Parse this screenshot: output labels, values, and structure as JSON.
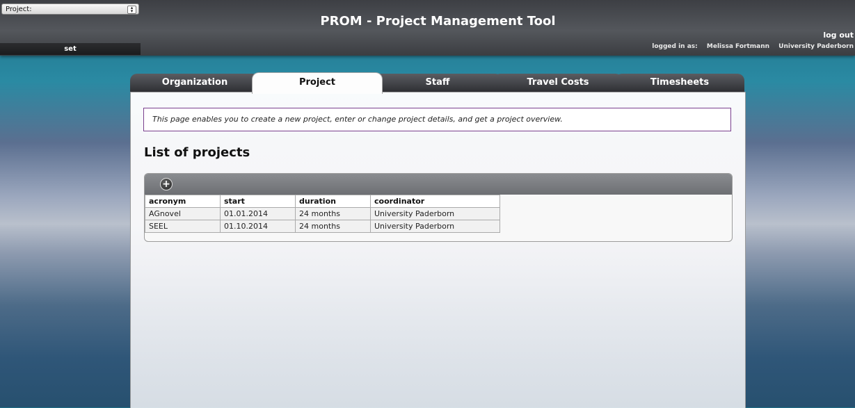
{
  "header": {
    "project_label": "Project:",
    "set_label": "set",
    "title": "PROM - Project Management Tool",
    "logout_label": "log out",
    "logged_in_label": "logged in as:",
    "user_name": "Melissa Fortmann",
    "organization": "University Paderborn"
  },
  "tabs": [
    {
      "label": "Organization"
    },
    {
      "label": "Project"
    },
    {
      "label": "Staff"
    },
    {
      "label": "Travel Costs"
    },
    {
      "label": "Timesheets"
    }
  ],
  "info_text": "This page enables you to create a new project, enter or change project details, and get a project overview.",
  "section_title": "List of projects",
  "table": {
    "add_icon": "plus-circle-icon",
    "columns": [
      "acronym",
      "start",
      "duration",
      "coordinator"
    ],
    "rows": [
      [
        "AGnovel",
        "01.01.2014",
        "24 months",
        "University Paderborn"
      ],
      [
        "SEEL",
        "01.10.2014",
        "24 months",
        "University Paderborn"
      ]
    ]
  },
  "colors": {
    "header_bg": "#4a4c51",
    "info_border": "#7a3f8e",
    "tab_dark": "#3a3b3f"
  }
}
